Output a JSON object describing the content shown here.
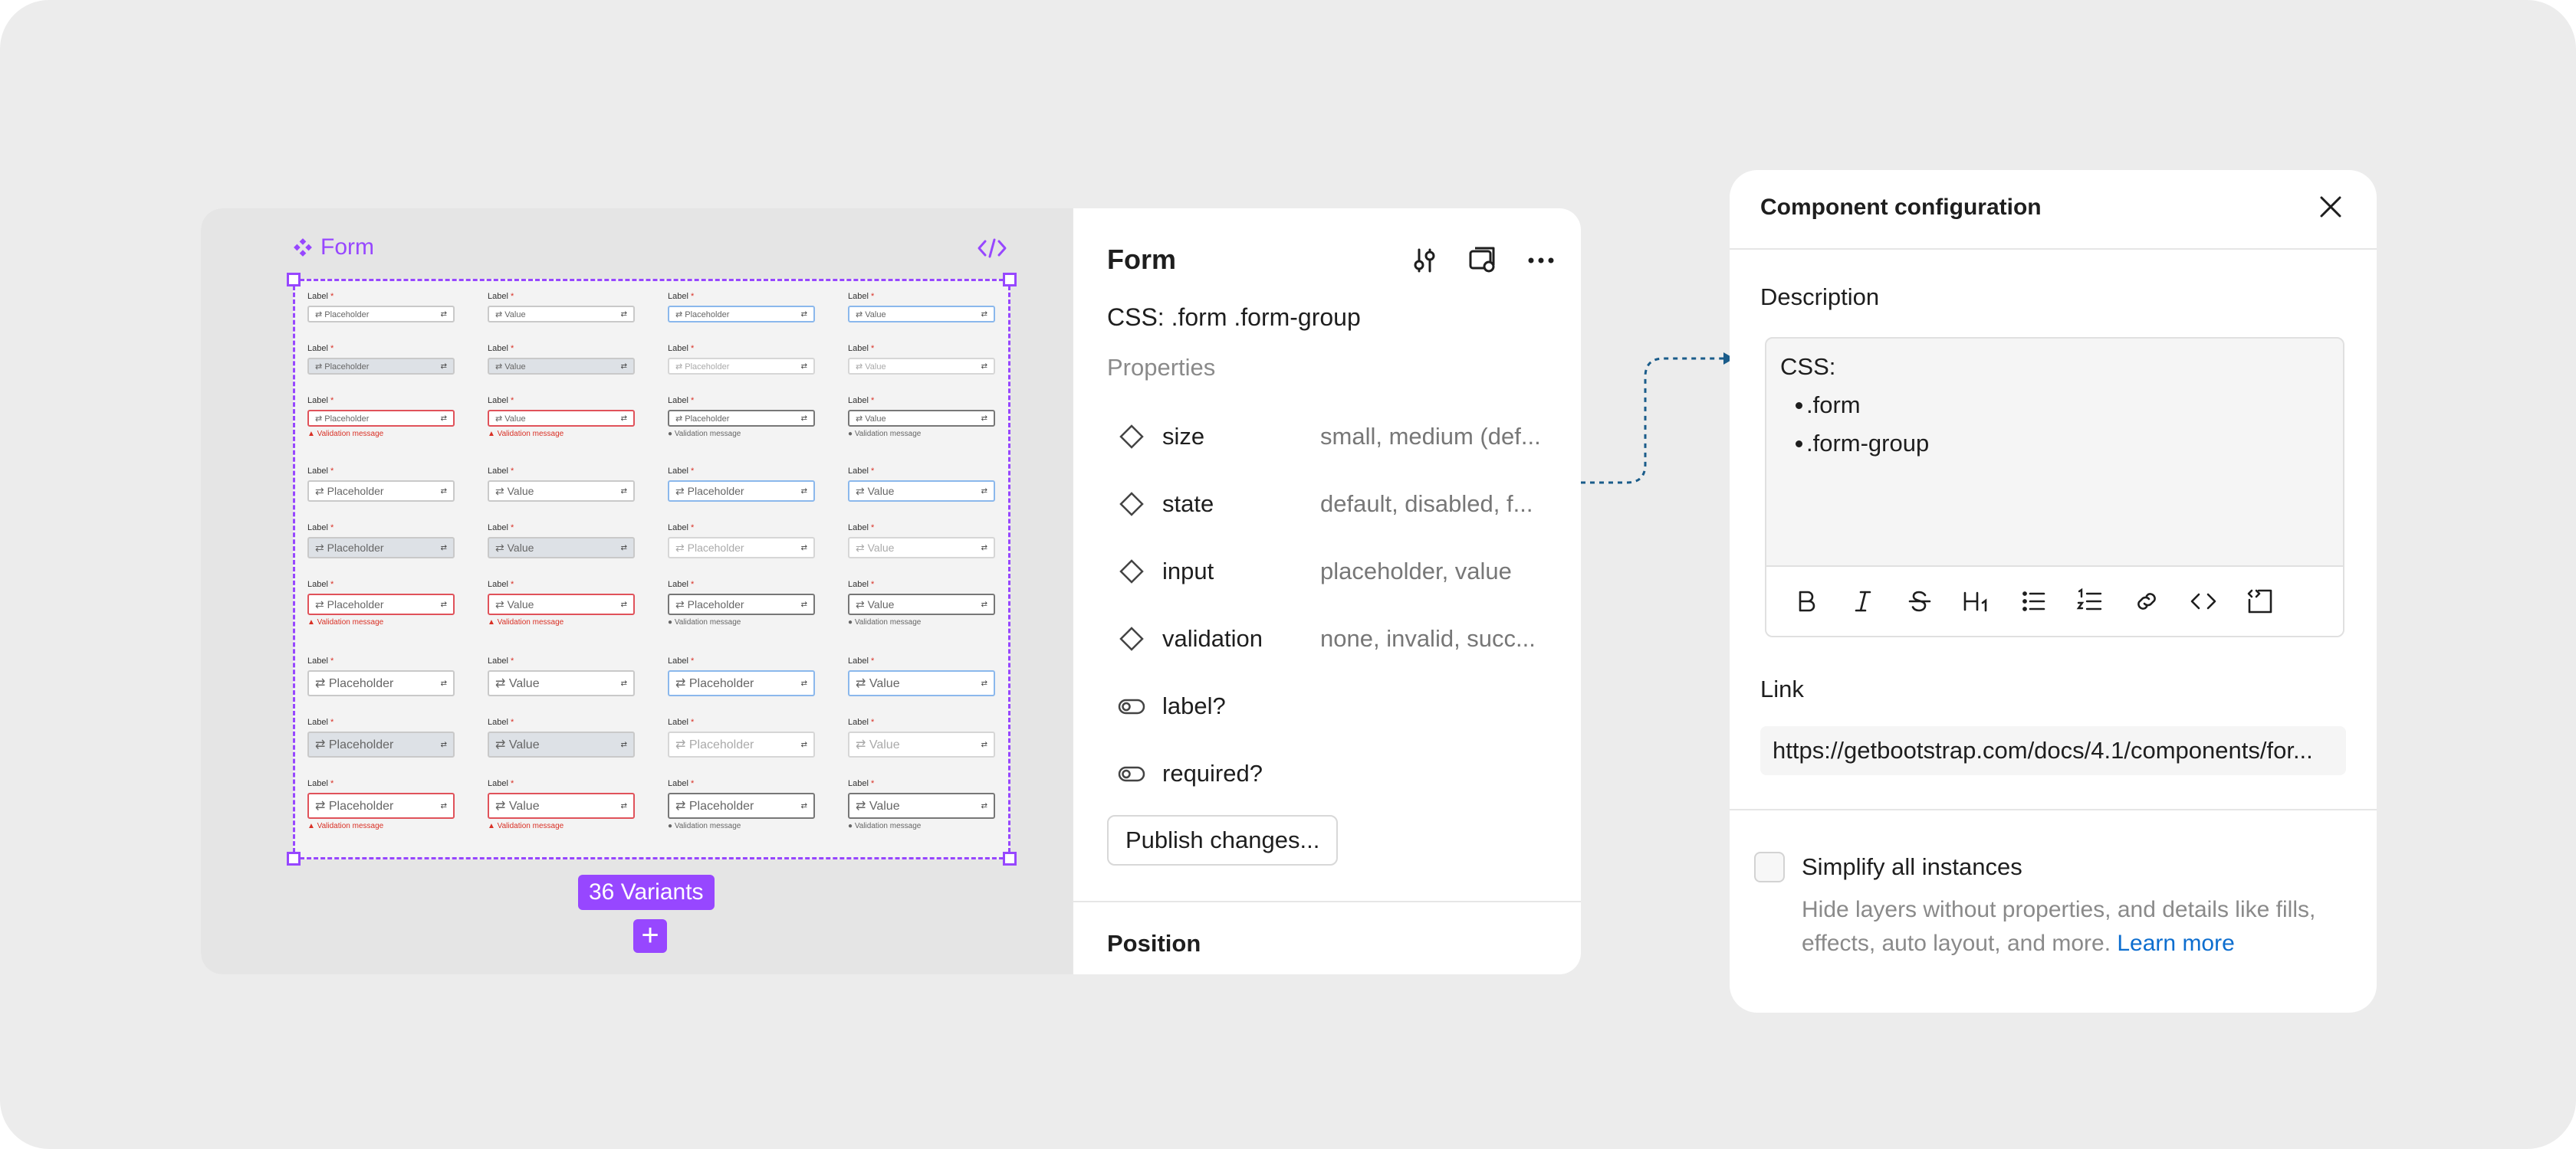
{
  "canvas": {
    "component_name": "Form",
    "variants_label": "36 Variants",
    "cells": [
      [
        {
          "label": "Label",
          "text": "Placeholder",
          "state": "default"
        },
        {
          "label": "Label",
          "text": "Value",
          "state": "default"
        },
        {
          "label": "Label",
          "text": "Placeholder",
          "state": "focus"
        },
        {
          "label": "Label",
          "text": "Value",
          "state": "focus"
        }
      ],
      [
        {
          "label": "Label",
          "text": "Placeholder",
          "state": "disabled"
        },
        {
          "label": "Label",
          "text": "Value",
          "state": "disabled"
        },
        {
          "label": "Label",
          "text": "Placeholder",
          "state": "ghost"
        },
        {
          "label": "Label",
          "text": "Value",
          "state": "ghost"
        }
      ],
      [
        {
          "label": "Label",
          "text": "Placeholder",
          "state": "invalid",
          "msg": "Validation message"
        },
        {
          "label": "Label",
          "text": "Value",
          "state": "invalid",
          "msg": "Validation message"
        },
        {
          "label": "Label",
          "text": "Placeholder",
          "state": "success",
          "msg": "Validation message"
        },
        {
          "label": "Label",
          "text": "Value",
          "state": "success",
          "msg": "Validation message"
        }
      ],
      [
        {
          "label": "Label",
          "text": "Placeholder",
          "state": "default"
        },
        {
          "label": "Label",
          "text": "Value",
          "state": "default"
        },
        {
          "label": "Label",
          "text": "Placeholder",
          "state": "focus"
        },
        {
          "label": "Label",
          "text": "Value",
          "state": "focus"
        }
      ],
      [
        {
          "label": "Label",
          "text": "Placeholder",
          "state": "disabled"
        },
        {
          "label": "Label",
          "text": "Value",
          "state": "disabled"
        },
        {
          "label": "Label",
          "text": "Placeholder",
          "state": "ghost"
        },
        {
          "label": "Label",
          "text": "Value",
          "state": "ghost"
        }
      ],
      [
        {
          "label": "Label",
          "text": "Placeholder",
          "state": "invalid",
          "msg": "Validation message"
        },
        {
          "label": "Label",
          "text": "Value",
          "state": "invalid",
          "msg": "Validation message"
        },
        {
          "label": "Label",
          "text": "Placeholder",
          "state": "success",
          "msg": "Validation message"
        },
        {
          "label": "Label",
          "text": "Value",
          "state": "success",
          "msg": "Validation message"
        }
      ],
      [
        {
          "label": "Label",
          "text": "Placeholder",
          "state": "default"
        },
        {
          "label": "Label",
          "text": "Value",
          "state": "default"
        },
        {
          "label": "Label",
          "text": "Placeholder",
          "state": "focus"
        },
        {
          "label": "Label",
          "text": "Value",
          "state": "focus"
        }
      ],
      [
        {
          "label": "Label",
          "text": "Placeholder",
          "state": "disabled"
        },
        {
          "label": "Label",
          "text": "Value",
          "state": "disabled"
        },
        {
          "label": "Label",
          "text": "Placeholder",
          "state": "ghost"
        },
        {
          "label": "Label",
          "text": "Value",
          "state": "ghost"
        }
      ],
      [
        {
          "label": "Label",
          "text": "Placeholder",
          "state": "invalid",
          "msg": "Validation message"
        },
        {
          "label": "Label",
          "text": "Value",
          "state": "invalid",
          "msg": "Validation message"
        },
        {
          "label": "Label",
          "text": "Placeholder",
          "state": "success",
          "msg": "Validation message"
        },
        {
          "label": "Label",
          "text": "Value",
          "state": "success",
          "msg": "Validation message"
        }
      ]
    ]
  },
  "properties_panel": {
    "title": "Form",
    "css": "CSS: .form .form-group",
    "heading": "Properties",
    "props": [
      {
        "name": "size",
        "value": "small, medium (def...",
        "icon": "variant-icon"
      },
      {
        "name": "state",
        "value": "default, disabled, f...",
        "icon": "variant-icon"
      },
      {
        "name": "input",
        "value": "placeholder, value",
        "icon": "variant-icon"
      },
      {
        "name": "validation",
        "value": "none, invalid, succ...",
        "icon": "variant-icon"
      },
      {
        "name": "label?",
        "value": "",
        "icon": "toggle-icon"
      },
      {
        "name": "required?",
        "value": "",
        "icon": "toggle-icon"
      }
    ],
    "publish_label": "Publish changes...",
    "position_label": "Position"
  },
  "dialog": {
    "title": "Component configuration",
    "description_label": "Description",
    "description_lines": [
      "CSS:",
      ".form",
      ".form-group"
    ],
    "link_label": "Link",
    "link_value": "https://getbootstrap.com/docs/4.1/components/for...",
    "simplify_label": "Simplify all instances",
    "simplify_desc": "Hide layers without properties, and details like fills, effects, auto layout, and more.",
    "learn_more": "Learn more"
  },
  "colors": {
    "accent": "#9747ff",
    "link": "#0d6ecf",
    "connector": "#1a5c8a"
  }
}
